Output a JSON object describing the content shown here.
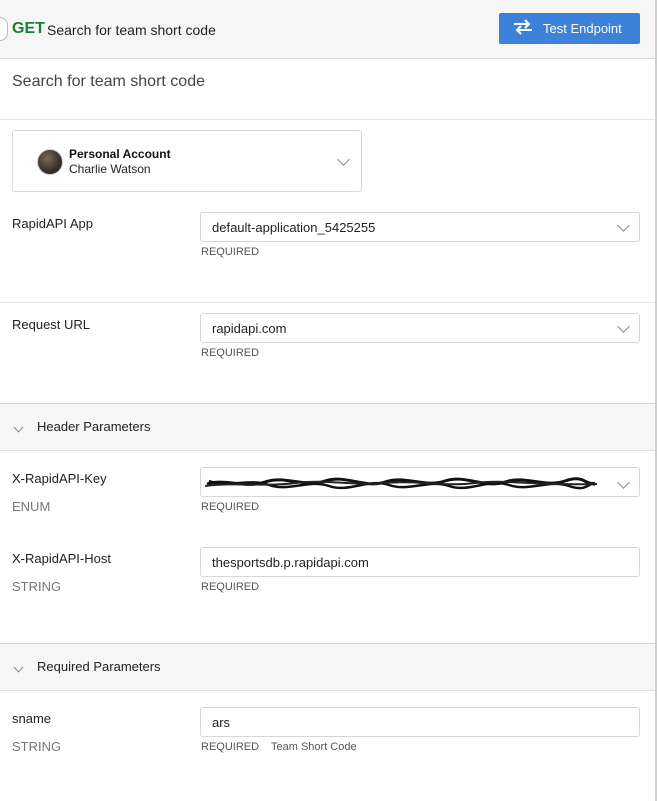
{
  "header": {
    "method": "GET",
    "endpoint_name": "Search for team short code",
    "test_button_label": "Test Endpoint"
  },
  "description": "Search for team short code",
  "account": {
    "type_label": "Personal Account",
    "user_name": "Charlie Watson"
  },
  "fields": {
    "rapidapi_app": {
      "label": "RapidAPI App",
      "value": "default-application_5425255",
      "required": "REQUIRED"
    },
    "request_url": {
      "label": "Request URL",
      "value": "rapidapi.com",
      "required": "REQUIRED"
    }
  },
  "header_params": {
    "title": "Header Parameters",
    "items": [
      {
        "name": "X-RapidAPI-Key",
        "type": "ENUM",
        "value": "",
        "required": "REQUIRED"
      },
      {
        "name": "X-RapidAPI-Host",
        "type": "STRING",
        "value": "thesportsdb.p.rapidapi.com",
        "required": "REQUIRED"
      }
    ]
  },
  "required_params": {
    "title": "Required Parameters",
    "items": [
      {
        "name": "sname",
        "type": "STRING",
        "value": "ars",
        "required": "REQUIRED",
        "hint": "Team Short Code"
      }
    ]
  },
  "colors": {
    "method_get": "#1a7f37",
    "primary_button": "#3b82d8",
    "section_bg": "#f6f6f6"
  },
  "icons": {
    "test_button": "swap-arrows-icon",
    "dropdown": "chevron-down-icon",
    "section_toggle": "chevron-down-icon"
  }
}
